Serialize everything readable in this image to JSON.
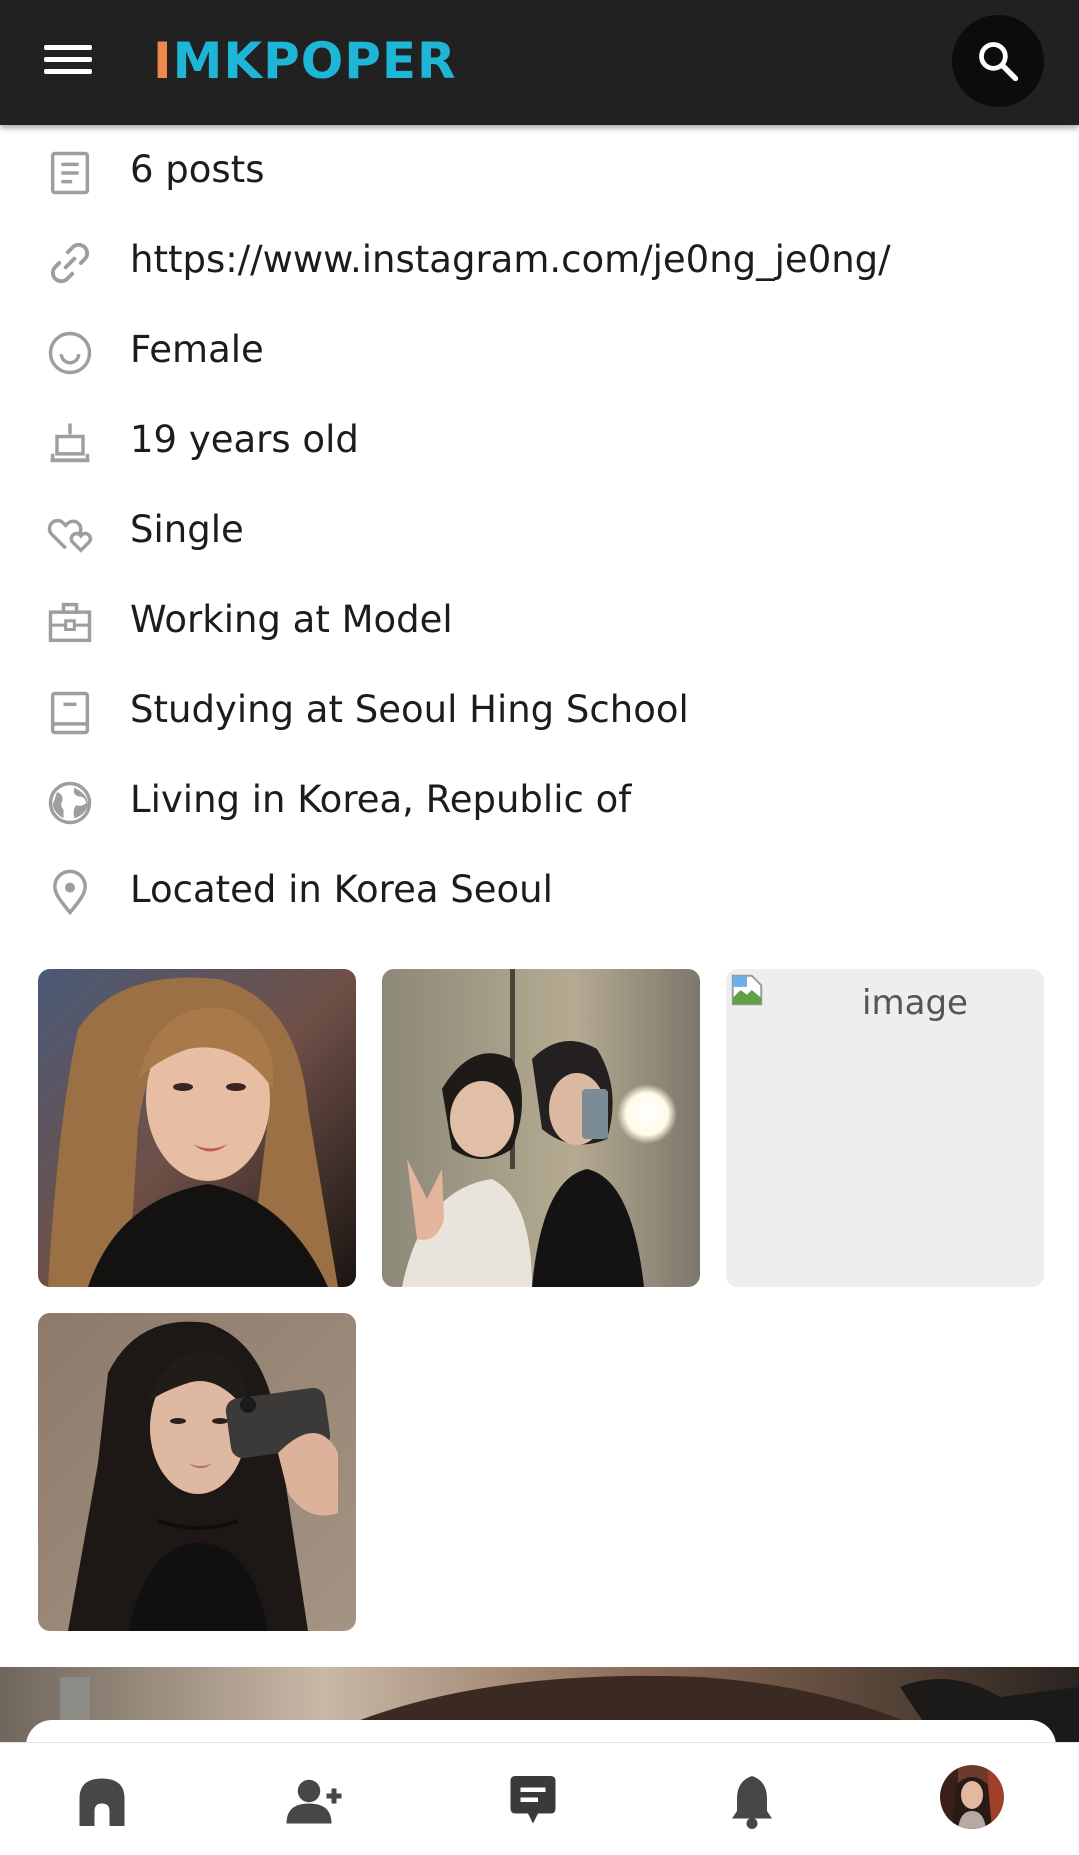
{
  "header": {
    "logo_part1": "I",
    "logo_part2": "MKPOPER",
    "menu_icon": "hamburger-menu-icon",
    "search_icon": "search-icon"
  },
  "profile_info": [
    {
      "icon": "document-icon",
      "text": "6 posts"
    },
    {
      "icon": "link-icon",
      "text": "https://www.instagram.com/je0ng_je0ng/"
    },
    {
      "icon": "smile-icon",
      "text": "Female"
    },
    {
      "icon": "birthday-cake-icon",
      "text": "19 years old"
    },
    {
      "icon": "hearts-icon",
      "text": "Single"
    },
    {
      "icon": "briefcase-icon",
      "text": "Working at Model"
    },
    {
      "icon": "book-icon",
      "text": "Studying at Seoul Hing School"
    },
    {
      "icon": "globe-icon",
      "text": "Living in Korea, Republic of"
    },
    {
      "icon": "location-pin-icon",
      "text": "Located in Korea Seoul"
    }
  ],
  "photos": [
    {
      "kind": "photo"
    },
    {
      "kind": "photo"
    },
    {
      "kind": "broken",
      "alt": "image"
    },
    {
      "kind": "photo"
    }
  ],
  "bottom_nav": [
    {
      "icon": "home-icon"
    },
    {
      "icon": "add-friend-icon"
    },
    {
      "icon": "messages-icon"
    },
    {
      "icon": "notifications-bell-icon"
    },
    {
      "icon": "profile-avatar"
    }
  ],
  "colors": {
    "topbar": "#212121",
    "logo_orange": "#f08a4b",
    "logo_cyan": "#1eb6d6",
    "icon_gray": "#9e9e9e",
    "nav_icon": "#3a3a3a"
  }
}
